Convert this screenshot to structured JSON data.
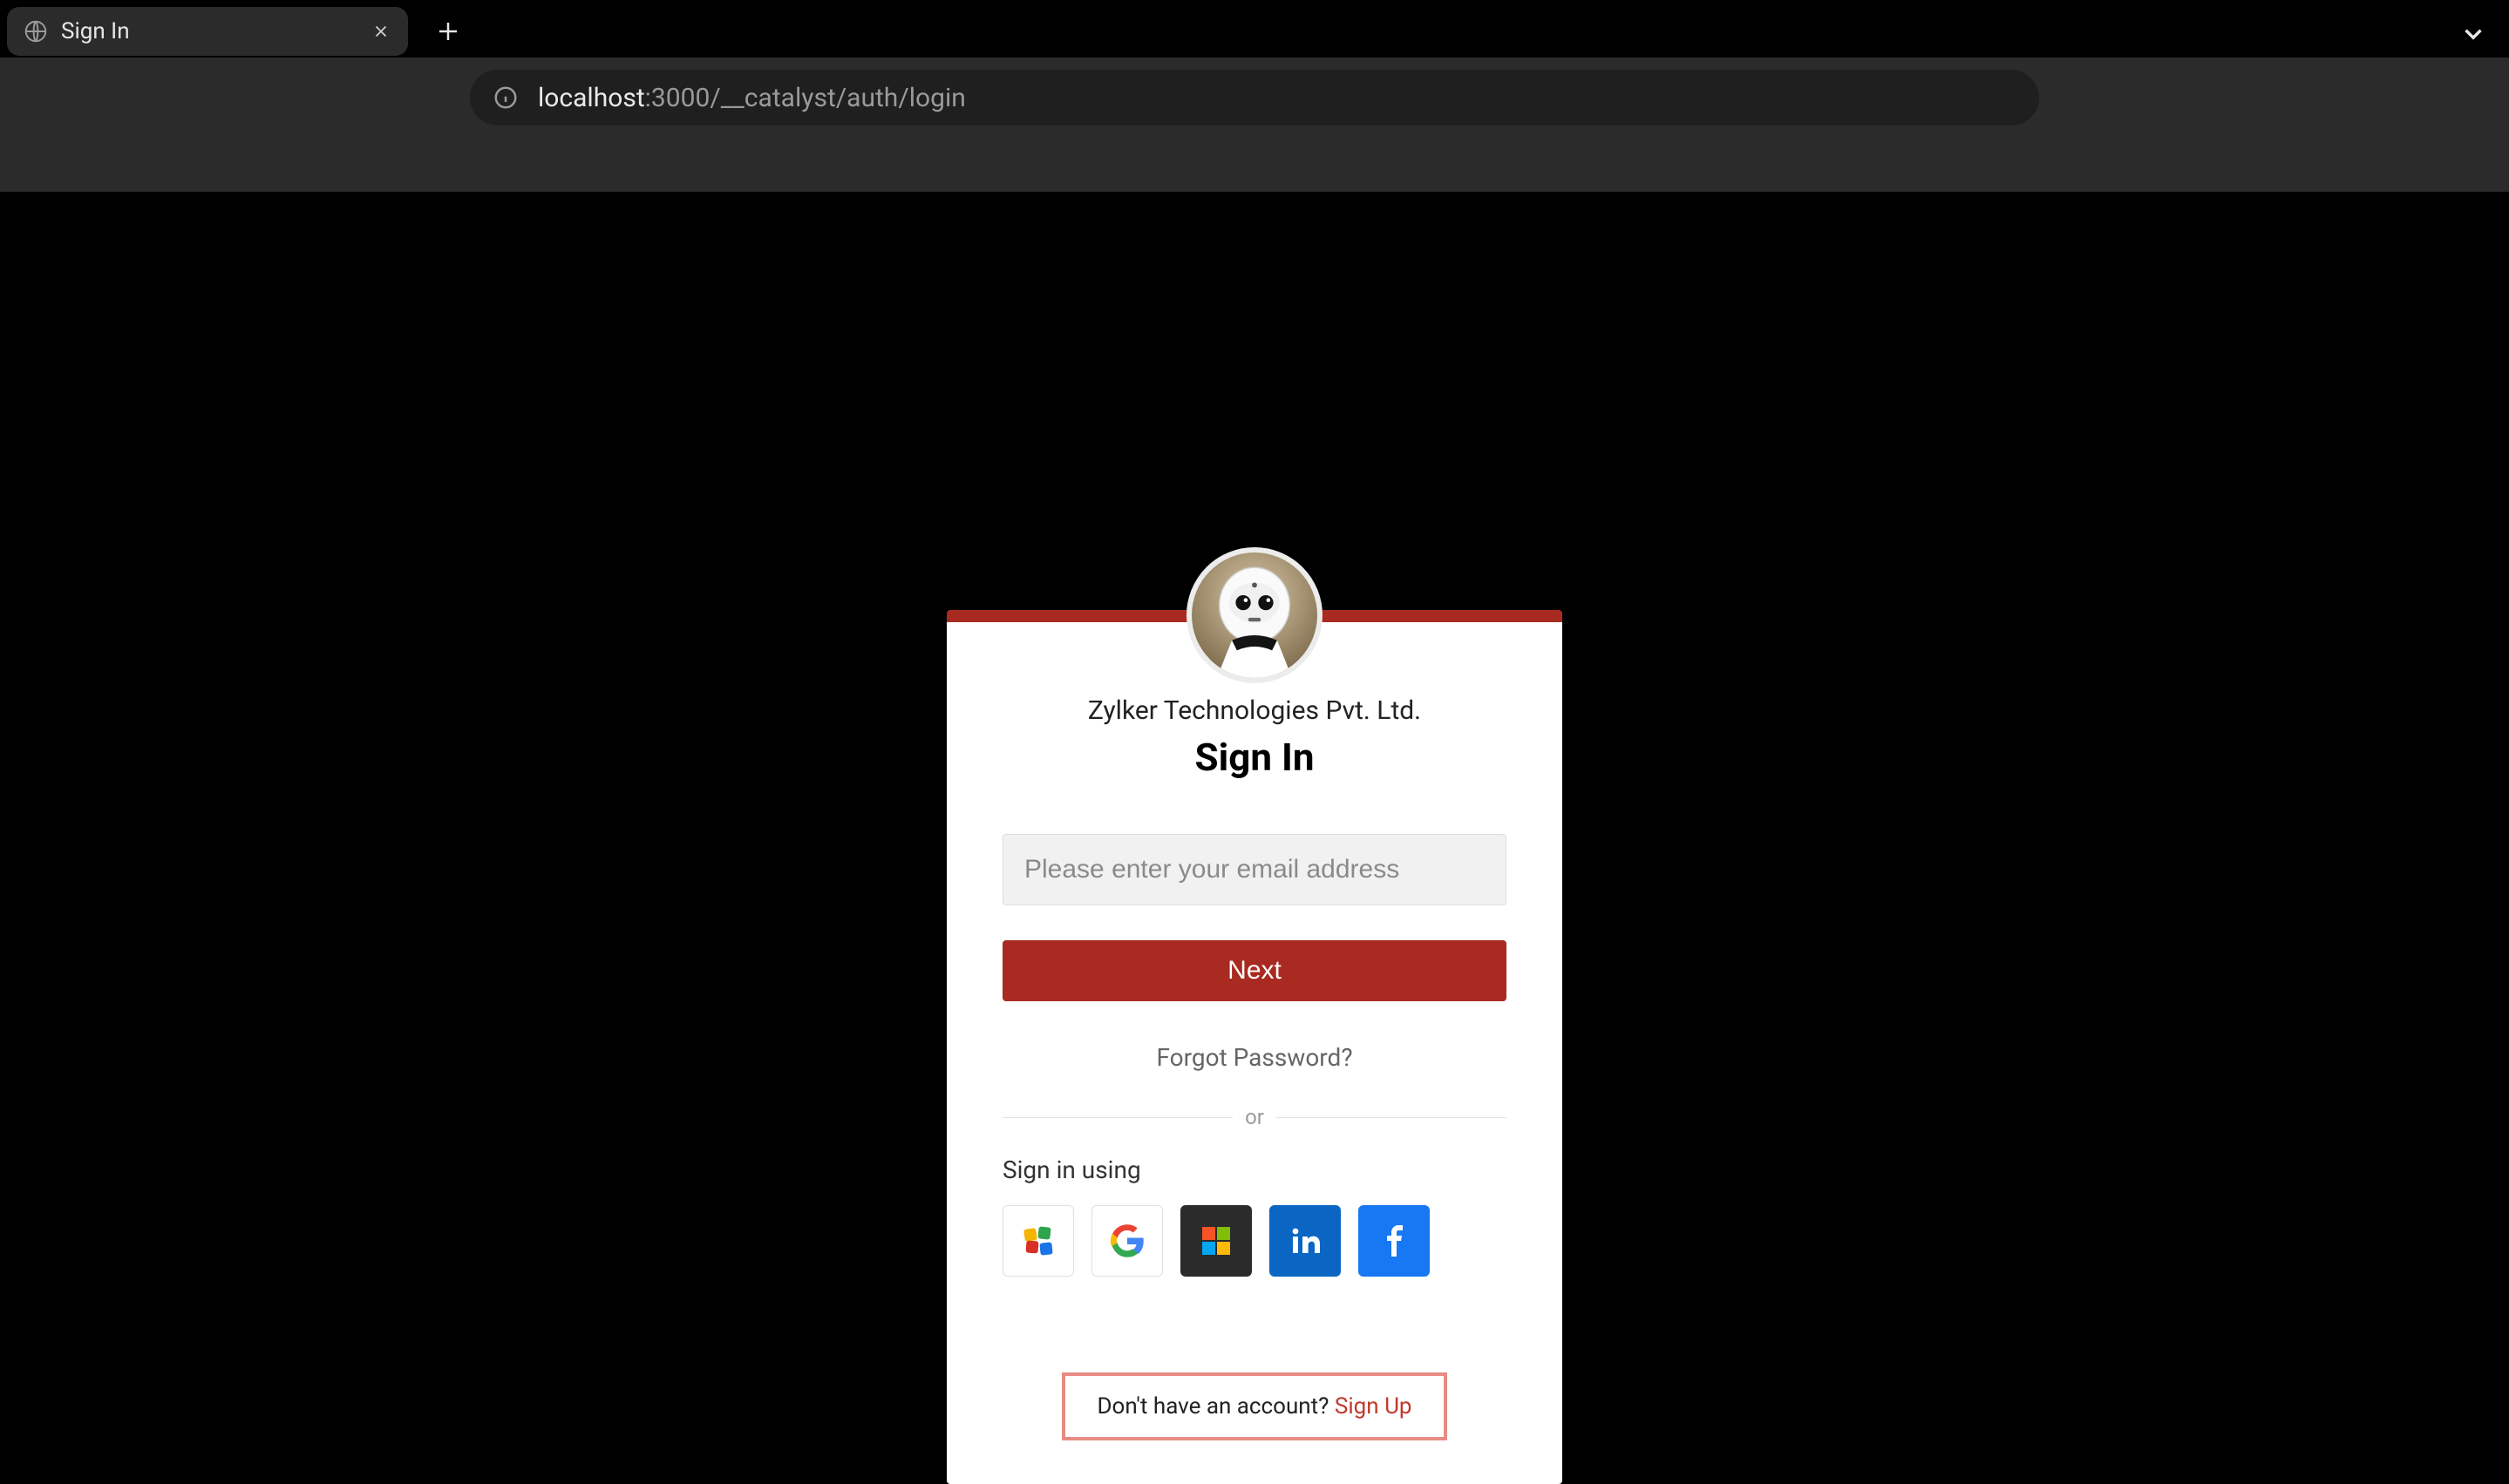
{
  "browser": {
    "tab_title": "Sign In",
    "address_host": "localhost",
    "address_path": ":3000/__catalyst/auth/login"
  },
  "card": {
    "company": "Zylker Technologies Pvt. Ltd.",
    "heading": "Sign In",
    "email_placeholder": "Please enter your email address",
    "next_label": "Next",
    "forgot_label": "Forgot Password?",
    "divider_label": "or",
    "signin_using_label": "Sign in using",
    "signup_prompt": "Don't have an account? ",
    "signup_link": "Sign Up"
  },
  "social": {
    "zoho": "zoho-icon",
    "google": "google-icon",
    "microsoft": "microsoft-icon",
    "linkedin": "linkedin-icon",
    "facebook": "facebook-icon"
  },
  "colors": {
    "accent": "#a82a20",
    "highlight_border": "#e78b83"
  }
}
